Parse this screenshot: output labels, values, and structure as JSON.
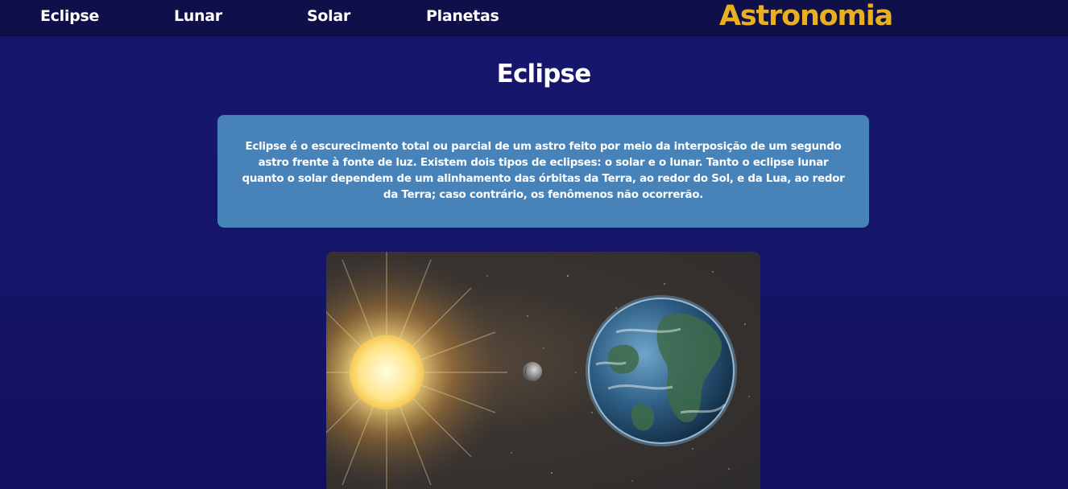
{
  "nav": {
    "items": [
      {
        "label": "Eclipse"
      },
      {
        "label": "Lunar"
      },
      {
        "label": "Solar"
      },
      {
        "label": "Planetas"
      }
    ],
    "brand": "Astronomia"
  },
  "main": {
    "title": "Eclipse",
    "description": "Eclipse é o escurecimento total ou parcial de um astro feito por meio da interposição de um segundo astro frente à fonte de luz. Existem dois tipos de eclipses: o solar e o lunar. Tanto o eclipse lunar quanto o solar dependem de um alinhamento das órbitas da Terra, ao redor do Sol, e da Lua, ao redor da Terra; caso contrário, os fenômenos não ocorrerão."
  },
  "image": {
    "subject": "eclipse-illustration",
    "elements": [
      "sun",
      "moon",
      "earth"
    ]
  },
  "colors": {
    "background": "#16166c",
    "topbar": "#0f0f4a",
    "brand": "#e8b01f",
    "info_box": "#4782b8"
  }
}
